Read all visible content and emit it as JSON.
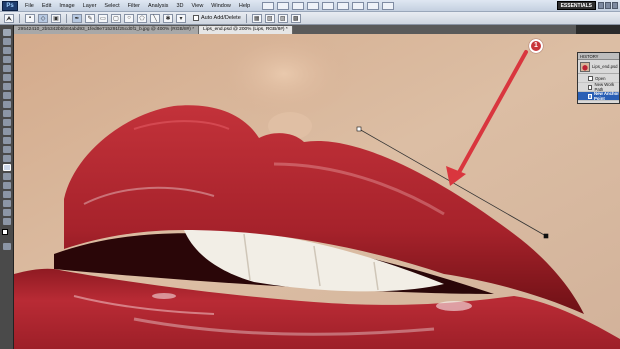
{
  "app": {
    "logo": "Ps",
    "workspace_label": "ESSENTIALS"
  },
  "menu": [
    "File",
    "Edit",
    "Image",
    "Layer",
    "Select",
    "Filter",
    "Analysis",
    "3D",
    "View",
    "Window",
    "Help"
  ],
  "options_bar": {
    "auto_add_delete_label": "Auto Add/Delete"
  },
  "document_tabs": [
    {
      "label": "29542410_2b5342b5b84abd93_1fed9e715291f25cd0f1_b.jpg @ 400% (RGB/8#) *",
      "active": false
    },
    {
      "label": "Lips_end.psd @ 200% (Lips, RGB/8#) *",
      "active": true
    }
  ],
  "history_panel": {
    "title": "HISTORY",
    "snapshot_label": "Lips_end.psd",
    "items": [
      {
        "label": "Open",
        "selected": false
      },
      {
        "label": "New Work Path",
        "selected": false
      },
      {
        "label": "New Anchor Point",
        "selected": true
      }
    ]
  },
  "annotation": {
    "step_number": "1"
  },
  "colors": {
    "accent_red": "#c8353a",
    "selection_blue": "#2a5fb5",
    "lip_red": "#b4232c",
    "skin": "#d9b89c"
  }
}
